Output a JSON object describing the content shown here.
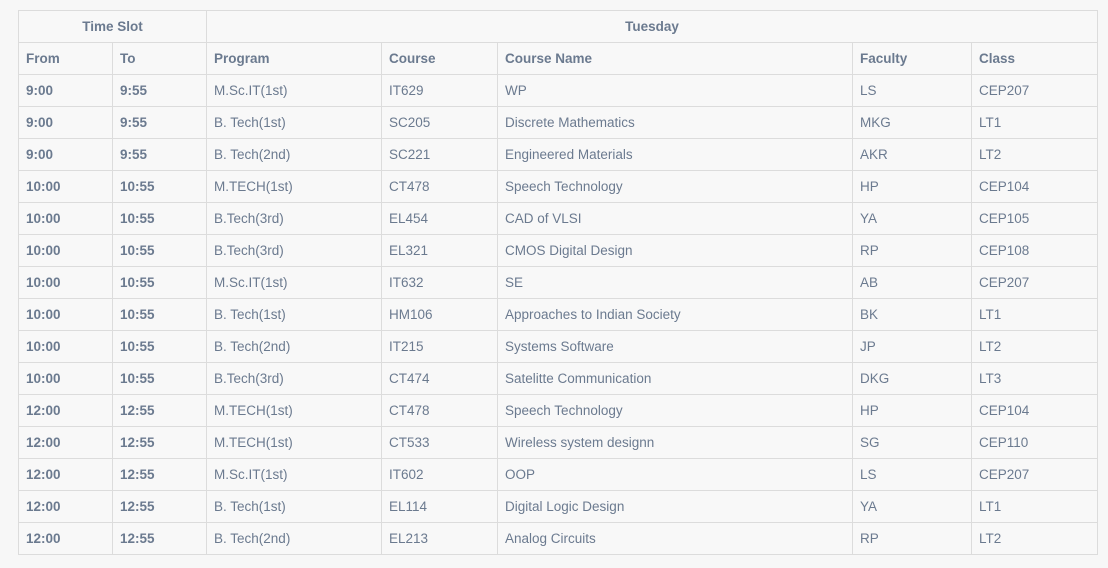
{
  "header": {
    "time_slot": "Time Slot",
    "day": "Tuesday",
    "columns": [
      "From",
      "To",
      "Program",
      "Course",
      "Course Name",
      "Faculty",
      "Class"
    ]
  },
  "rows": [
    {
      "from": "9:00",
      "to": "9:55",
      "program": "M.Sc.IT(1st)",
      "course": "IT629",
      "course_name": "WP",
      "faculty": "LS",
      "class": "CEP207"
    },
    {
      "from": "9:00",
      "to": "9:55",
      "program": "B. Tech(1st)",
      "course": "SC205",
      "course_name": "Discrete Mathematics",
      "faculty": "MKG",
      "class": "LT1"
    },
    {
      "from": "9:00",
      "to": "9:55",
      "program": "B. Tech(2nd)",
      "course": "SC221",
      "course_name": "Engineered Materials",
      "faculty": "AKR",
      "class": "LT2"
    },
    {
      "from": "10:00",
      "to": "10:55",
      "program": "M.TECH(1st)",
      "course": "CT478",
      "course_name": "Speech Technology",
      "faculty": "HP",
      "class": "CEP104"
    },
    {
      "from": "10:00",
      "to": "10:55",
      "program": "B.Tech(3rd)",
      "course": "EL454",
      "course_name": "CAD of VLSI",
      "faculty": "YA",
      "class": "CEP105"
    },
    {
      "from": "10:00",
      "to": "10:55",
      "program": "B.Tech(3rd)",
      "course": "EL321",
      "course_name": "CMOS Digital Design",
      "faculty": "RP",
      "class": "CEP108"
    },
    {
      "from": "10:00",
      "to": "10:55",
      "program": "M.Sc.IT(1st)",
      "course": "IT632",
      "course_name": "SE",
      "faculty": "AB",
      "class": "CEP207"
    },
    {
      "from": "10:00",
      "to": "10:55",
      "program": "B. Tech(1st)",
      "course": "HM106",
      "course_name": "Approaches to Indian Society",
      "faculty": "BK",
      "class": "LT1"
    },
    {
      "from": "10:00",
      "to": "10:55",
      "program": "B. Tech(2nd)",
      "course": "IT215",
      "course_name": "Systems Software",
      "faculty": "JP",
      "class": "LT2"
    },
    {
      "from": "10:00",
      "to": "10:55",
      "program": "B.Tech(3rd)",
      "course": "CT474",
      "course_name": "Satelitte Communication",
      "faculty": "DKG",
      "class": "LT3"
    },
    {
      "from": "12:00",
      "to": "12:55",
      "program": "M.TECH(1st)",
      "course": "CT478",
      "course_name": "Speech Technology",
      "faculty": "HP",
      "class": "CEP104"
    },
    {
      "from": "12:00",
      "to": "12:55",
      "program": "M.TECH(1st)",
      "course": "CT533",
      "course_name": "Wireless system designn",
      "faculty": "SG",
      "class": "CEP110"
    },
    {
      "from": "12:00",
      "to": "12:55",
      "program": "M.Sc.IT(1st)",
      "course": "IT602",
      "course_name": "OOP",
      "faculty": "LS",
      "class": "CEP207"
    },
    {
      "from": "12:00",
      "to": "12:55",
      "program": "B. Tech(1st)",
      "course": "EL114",
      "course_name": "Digital Logic Design",
      "faculty": "YA",
      "class": "LT1"
    },
    {
      "from": "12:00",
      "to": "12:55",
      "program": "B. Tech(2nd)",
      "course": "EL213",
      "course_name": "Analog Circuits",
      "faculty": "RP",
      "class": "LT2"
    }
  ]
}
